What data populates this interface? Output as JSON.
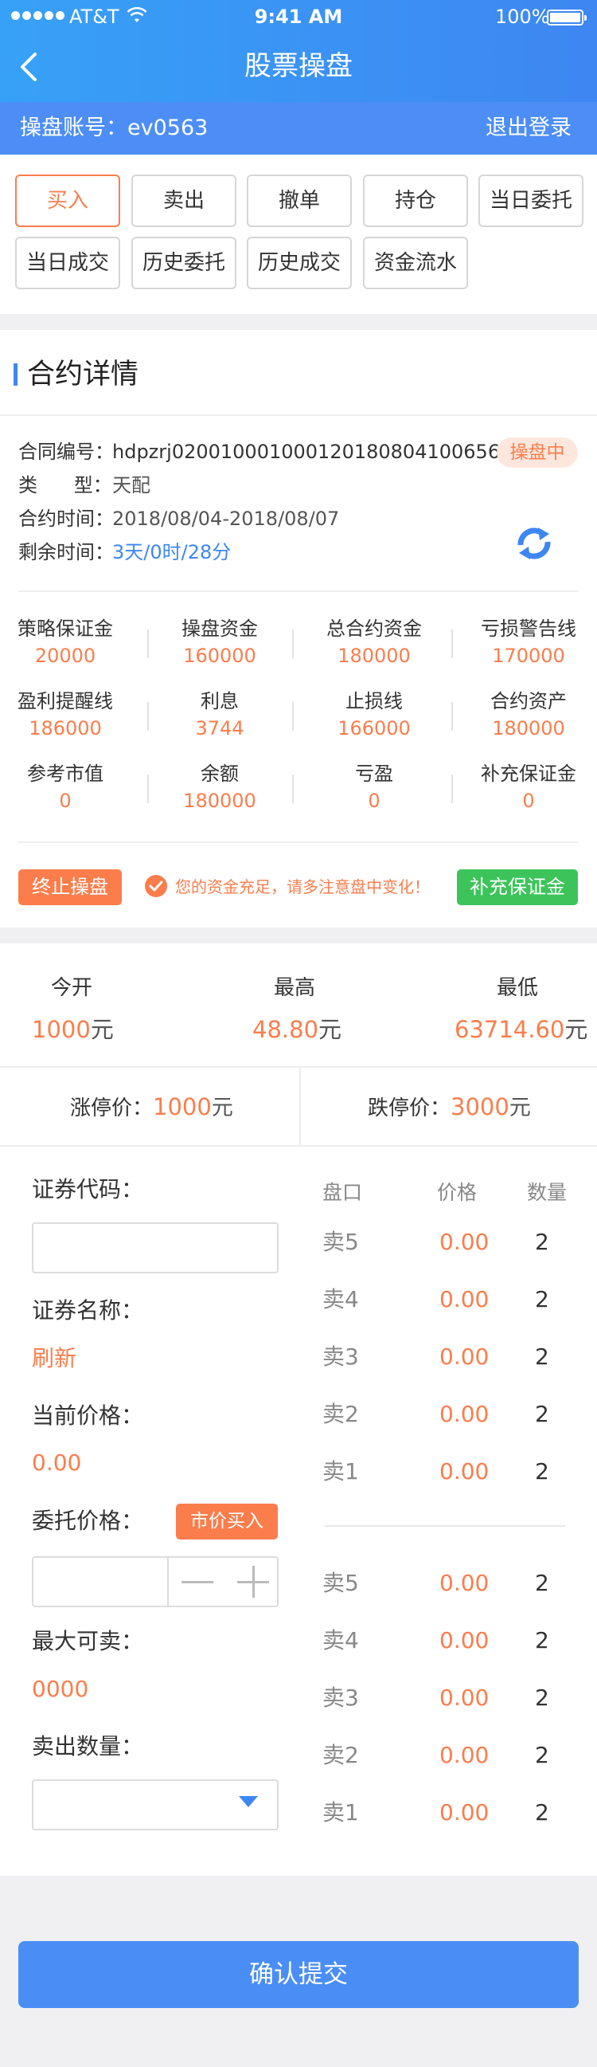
{
  "status_bar": {
    "carrier": "AT&T",
    "time": "9:41 AM",
    "battery": "100%"
  },
  "header": {
    "title": "股票操盘"
  },
  "account": {
    "label": "操盘账号：",
    "id": "ev0563",
    "logout": "退出登录"
  },
  "tabs": [
    {
      "label": "买入",
      "active": true
    },
    {
      "label": "卖出"
    },
    {
      "label": "撤单"
    },
    {
      "label": "持仓"
    },
    {
      "label": "当日委托"
    },
    {
      "label": "当日成交"
    },
    {
      "label": "历史委托"
    },
    {
      "label": "历史成交"
    },
    {
      "label": "资金流水"
    }
  ],
  "contract": {
    "title": "合约详情",
    "status": "操盘中",
    "rows": [
      {
        "key": "合同编号：",
        "value": "hdpzrj02001000100012018080410065６"
      },
      {
        "key": "类      型：",
        "value": "天配"
      },
      {
        "key": "合约时间：",
        "value": "2018/08/04-2018/08/07"
      },
      {
        "key": "剩余时间：",
        "value": "3天/0时/28分"
      }
    ],
    "stats": [
      {
        "label": "策略保证金",
        "value": "20000"
      },
      {
        "label": "操盘资金",
        "value": "160000"
      },
      {
        "label": "总合约资金",
        "value": "180000"
      },
      {
        "label": "亏损警告线",
        "value": "170000"
      },
      {
        "label": "盈利提醒线",
        "value": "186000"
      },
      {
        "label": "利息",
        "value": "3744"
      },
      {
        "label": "止损线",
        "value": "166000"
      },
      {
        "label": "合约资产",
        "value": "180000"
      },
      {
        "label": "参考市值",
        "value": "0"
      },
      {
        "label": "余额",
        "value": "180000"
      },
      {
        "label": "亏盈",
        "value": "0"
      },
      {
        "label": "补充保证金",
        "value": "0"
      }
    ],
    "stop_button": "终止操盘",
    "notice": "您的资金充足，请多注意盘中变化！",
    "margin_button": "补充保证金"
  },
  "quote": {
    "open_label": "今开",
    "open_value": "1000",
    "open_unit": "元",
    "high_label": "最高",
    "high_value": "48.80",
    "high_unit": "元",
    "low_label": "最低",
    "low_value": "63714.60",
    "low_unit": "元",
    "limit_up_label": "涨停价：",
    "limit_up_value": "1000",
    "limit_up_unit": "元",
    "limit_down_label": "跌停价：",
    "limit_down_value": "3000",
    "limit_down_unit": "元"
  },
  "form": {
    "code_label": "证券代码：",
    "code_value": "",
    "name_label": "证券名称：",
    "name_value": "刷新",
    "price_label": "当前价格：",
    "price_value": "0.00",
    "order_price_label": "委托价格：",
    "market_buy": "市价买入",
    "max_label": "最大可卖：",
    "max_value": "0000",
    "qty_label": "卖出数量："
  },
  "orderbook": {
    "headers": [
      "盘口",
      "价格",
      "数量"
    ],
    "top": [
      {
        "level": "卖5",
        "price": "0.00",
        "qty": "2"
      },
      {
        "level": "卖4",
        "price": "0.00",
        "qty": "2"
      },
      {
        "level": "卖3",
        "price": "0.00",
        "qty": "2"
      },
      {
        "level": "卖2",
        "price": "0.00",
        "qty": "2"
      },
      {
        "level": "卖1",
        "price": "0.00",
        "qty": "2"
      }
    ],
    "bottom": [
      {
        "level": "卖5",
        "price": "0.00",
        "qty": "2"
      },
      {
        "level": "卖4",
        "price": "0.00",
        "qty": "2"
      },
      {
        "level": "卖3",
        "price": "0.00",
        "qty": "2"
      },
      {
        "level": "卖2",
        "price": "0.00",
        "qty": "2"
      },
      {
        "level": "卖1",
        "price": "0.00",
        "qty": "2"
      }
    ]
  },
  "submit": "确认提交",
  "colors": {
    "accent": "#3e86f2",
    "orange": "#fb7d4c",
    "green": "#3cc45a"
  },
  "icons": [
    "signal-dots-icon",
    "wifi-icon",
    "battery-icon",
    "back-arrow-icon",
    "refresh-icon",
    "check-circle-icon",
    "minus-icon",
    "plus-icon",
    "dropdown-caret-icon"
  ]
}
